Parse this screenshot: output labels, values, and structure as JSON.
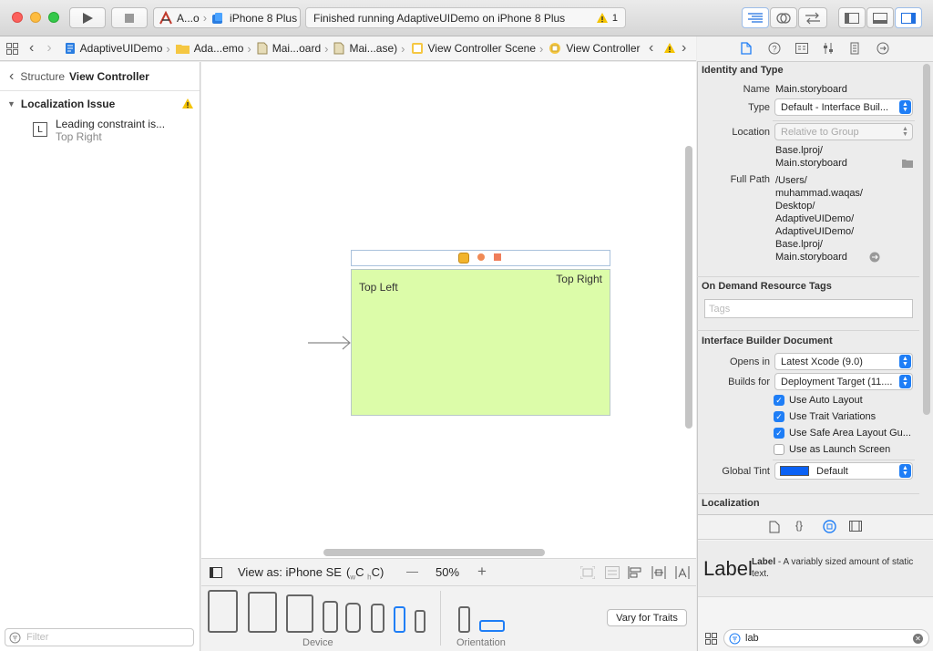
{
  "toolbar": {
    "scheme_name": "A...o",
    "destination": "iPhone 8 Plus",
    "status_text": "Finished running AdaptiveUIDemo on iPhone 8 Plus",
    "warning_count": "1"
  },
  "breadcrumbs": [
    "AdaptiveUIDemo",
    "Ada...emo",
    "Mai...oard",
    "Mai...ase)",
    "View Controller Scene",
    "View Controller"
  ],
  "issues": {
    "back_label": "Structure",
    "title": "View Controller",
    "group_label": "Localization Issue",
    "item_title": "Leading constraint is...",
    "item_subtitle": "Top Right",
    "filter_placeholder": "Filter"
  },
  "canvas": {
    "label_left": "Top Left",
    "label_right": "Top Right",
    "view_as": "View as: iPhone SE",
    "size_class_w": "w",
    "size_class_c1": "C",
    "size_class_h": "h",
    "size_class_c2": "C",
    "zoom": "50%",
    "zoom_minus": "—",
    "zoom_plus": "+",
    "device_label": "Device",
    "orientation_label": "Orientation",
    "vary_button": "Vary for Traits"
  },
  "inspector": {
    "identity_header": "Identity and Type",
    "name_label": "Name",
    "name_value": "Main.storyboard",
    "type_label": "Type",
    "type_value": "Default - Interface Buil...",
    "location_label": "Location",
    "location_value": "Relative to Group",
    "location_path_1": "Base.lproj/",
    "location_path_2": "Main.storyboard",
    "fullpath_label": "Full Path",
    "fullpath_lines": [
      "/Users/",
      "muhammad.waqas/",
      "Desktop/",
      "AdaptiveUIDemo/",
      "AdaptiveUIDemo/",
      "Base.lproj/",
      "Main.storyboard"
    ],
    "ondemand_header": "On Demand Resource Tags",
    "tags_placeholder": "Tags",
    "ibdoc_header": "Interface Builder Document",
    "opens_label": "Opens in",
    "opens_value": "Latest Xcode (9.0)",
    "builds_label": "Builds for",
    "builds_value": "Deployment Target (11....",
    "checkbox_1": "Use Auto Layout",
    "checkbox_2": "Use Trait Variations",
    "checkbox_3": "Use Safe Area Layout Gu...",
    "checkbox_4": "Use as Launch Screen",
    "tint_label": "Global Tint",
    "tint_value": "Default",
    "tint_color": "#0a61f5",
    "localization_header": "Localization"
  },
  "library": {
    "item_big": "Label",
    "item_name": "Label",
    "item_desc": " - A variably sized amount of static text.",
    "search_value": "lab"
  },
  "colors": {
    "accent": "#1f7ef6",
    "view_bg": "#dcfca9",
    "warning": "#f5c400"
  }
}
